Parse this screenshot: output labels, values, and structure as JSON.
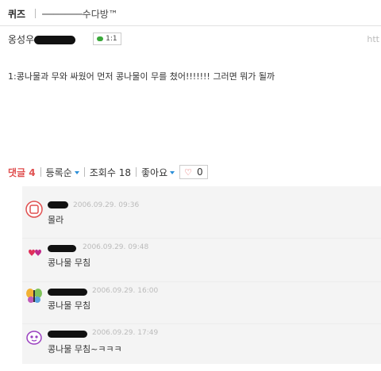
{
  "header": {
    "category": "퀴즈",
    "board": "───────수다방™"
  },
  "post": {
    "author_prefix": "옹성우",
    "comment_badge": "1:1",
    "url_hint": "htt",
    "body": "1:콩나물과 무와 싸웠어 먼저 콩나물이 무를 쳤어!!!!!!! 그러면 뭐가 될까"
  },
  "toolbar": {
    "comments_label": "댓글",
    "comments_count": "4",
    "sort_label": "등록순",
    "views_label": "조회수",
    "views_count": "18",
    "like_label": "좋아요",
    "like_count": "0"
  },
  "comments": [
    {
      "date": "2006.09.29. 09:36",
      "text": "몰라",
      "avatar": "bear-avatar-icon"
    },
    {
      "date": "2006.09.29. 09:48",
      "text": "콩나물 무침",
      "avatar": "hearts-avatar-icon"
    },
    {
      "date": "2006.09.29. 16:00",
      "text": "콩나물 무침",
      "avatar": "butterfly-avatar-icon"
    },
    {
      "date": "2006.09.29. 17:49",
      "text": "콩나물 무침~ㅋㅋㅋ",
      "avatar": "ghost-avatar-icon"
    }
  ],
  "colors": {
    "accent_red": "#e05050",
    "caret_blue": "#2c8fd8",
    "comment_bg": "#f4f4f4"
  }
}
